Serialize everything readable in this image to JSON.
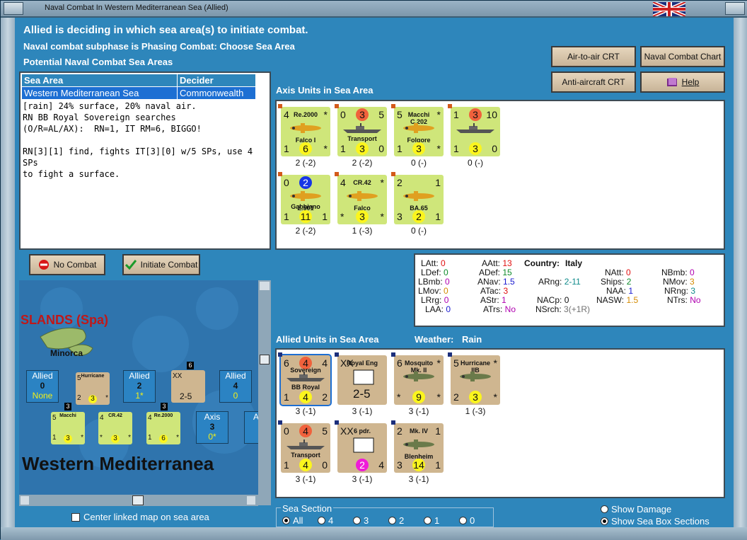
{
  "window": {
    "title": "Naval Combat In Western Mediterranean Sea (Allied)"
  },
  "header": {
    "line1": "Allied is deciding in which sea area(s) to initiate combat.",
    "line2": "Naval combat subphase is Phasing Combat: Choose Sea Area",
    "line3": "Potential Naval Combat Sea Areas"
  },
  "buttons": {
    "air_to_air": "Air-to-air CRT",
    "naval_chart": "Naval Combat Chart",
    "anti_aircraft": "Anti-aircraft CRT",
    "help": "Help",
    "no_combat": "No Combat",
    "initiate_combat": "Initiate Combat"
  },
  "sea_table": {
    "headers": [
      "Sea Area",
      "Decider"
    ],
    "rows": [
      [
        "Western Mediterranean Sea",
        "Commonwealth"
      ]
    ]
  },
  "log": "[rain] 24% surface, 20% naval air.\nRN BB Royal Sovereign searches\n(O/R=AL/AX):  RN=1, IT RM=6, BIGGO!\n\nRN[3][1] find, fights IT[3][0] w/5 SPs, use 4 SPs\nto fight a surface.",
  "axis_section": {
    "title": "Axis Units in Sea Area"
  },
  "allied_section": {
    "title": "Allied Units in Sea Area",
    "weather_label": "Weather:",
    "weather": "Rain"
  },
  "axis_units": [
    {
      "tl": "4",
      "name": "Re.2000",
      "sub": "Falco I",
      "bl": "1",
      "bm": "6",
      "br": "*",
      "tr": "*",
      "caption": "2 (-2)"
    },
    {
      "tl": "0",
      "tm": "3",
      "tr": "5",
      "name": "Transport",
      "bl": "1",
      "bm": "3",
      "br": "0",
      "caption": "2 (-2)"
    },
    {
      "tl": "5",
      "name": "Macchi",
      "name2": "C.202",
      "sub": "Folgore",
      "bl": "1",
      "bm": "3",
      "br": "*",
      "tr": "*",
      "caption": "0 (-)"
    },
    {
      "tl": "1",
      "tm": "3",
      "tr": "10",
      "bl": "1",
      "bm": "3",
      "br": "0",
      "caption": "0 (-)"
    },
    {
      "tl": "0",
      "name": "Gabbiano",
      "tm": "2",
      "sub": "Z.501",
      "bl": "1",
      "bm": "11",
      "br": "1",
      "caption": "2 (-2)"
    },
    {
      "tl": "4",
      "name": "CR.42",
      "sub": "Falco",
      "bl": "*",
      "bm": "3",
      "br": "*",
      "tr": "*",
      "caption": "1 (-3)"
    },
    {
      "tl": "2",
      "tr": "1",
      "sub": "BA.65",
      "bl": "3",
      "bm": "2",
      "br": "1",
      "caption": "0 (-)"
    }
  ],
  "allied_units": [
    {
      "tl": "6",
      "tm": "4",
      "tr": "4",
      "name": "BB Royal",
      "name2": "Sovereign",
      "bl": "1",
      "bm": "4",
      "br": "2",
      "caption": "3 (-1)"
    },
    {
      "tl": "XX",
      "name": "Royal Eng",
      "bm": "2-5",
      "caption": "3 (-1)"
    },
    {
      "tl": "6",
      "name": "Mosquito",
      "name2": "Mk. II",
      "bl": "*",
      "bm": "9",
      "br": "*",
      "tr": "*",
      "caption": "3 (-1)"
    },
    {
      "tl": "5",
      "name": "Hurricane",
      "name2": "IIB",
      "bl": "2",
      "bm": "3",
      "br": "*",
      "tr": "*",
      "caption": "1 (-3)"
    },
    {
      "tl": "0",
      "tm": "4",
      "tr": "5",
      "name": "Transport",
      "bl": "1",
      "bm": "4",
      "br": "0",
      "caption": "3 (-1)"
    },
    {
      "tl": "XX",
      "name": "6 pdr.",
      "bm": "2",
      "br": "4",
      "caption": "3 (-1)"
    },
    {
      "tl": "2",
      "tr": "1",
      "name": "Mk. IV",
      "sub": "Blenheim",
      "bl": "3",
      "bm": "14",
      "br": "1",
      "caption": "3 (-1)"
    }
  ],
  "stats": {
    "country_label": "Country:",
    "country": "Italy",
    "LAtt": "0",
    "LDef": "0",
    "LBmb": "0",
    "LMov": "0",
    "LRrg": "0",
    "LAA": "0",
    "AAtt": "13",
    "ADef": "15",
    "ANav": "1.5",
    "ATac": "3",
    "AStr": "1",
    "ATrs": "No",
    "ARng": "2-11",
    "NACp": "0",
    "NSrch": "3",
    "NSrch_extra": "(+1R)",
    "NAtt": "0",
    "Ships": "2",
    "NAA": "1",
    "NASW": "1.5",
    "NBmb": "0",
    "NMov": "3",
    "NRng": "3",
    "NTrs": "No"
  },
  "map": {
    "region": "SLANDS (Spa)",
    "island": "Minorca",
    "sea_name": "Western Mediterranea",
    "boxes": [
      {
        "side": "Allied",
        "value": "0",
        "note": "None"
      },
      {
        "side": "Allied",
        "value": "2",
        "note": "1*"
      },
      {
        "side": "Allied",
        "value": "4",
        "note": "0"
      },
      {
        "side": "Axis",
        "value": "3",
        "note": "0*"
      },
      {
        "side": "As",
        "value": "",
        "note": ""
      }
    ],
    "stack_counts": [
      "6",
      "3",
      "3",
      "3"
    ],
    "counters": [
      {
        "tl": "5",
        "name": "Hurricane",
        "name2": "IIB",
        "bl": "2",
        "bm": "3",
        "br": "*"
      },
      {
        "tl": "XX",
        "name": "",
        "bm": "2-5"
      },
      {
        "tl": "5",
        "name": "Macchi",
        "name2": "C.202",
        "sub": "Folgore",
        "bl": "1",
        "bm": "3",
        "br": "*"
      },
      {
        "tl": "4",
        "name": "CR.42",
        "sub": "Falco",
        "bl": "*",
        "bm": "3",
        "br": "*"
      },
      {
        "tl": "4",
        "name": "Re.2000",
        "sub": "Falco I",
        "bl": "1",
        "bm": "6",
        "br": "*"
      }
    ]
  },
  "bottom": {
    "center_map": "Center linked map on sea area",
    "sea_section_label": "Sea Section",
    "sea_section_options": [
      "All",
      "4",
      "3",
      "2",
      "1",
      "0"
    ],
    "show_damage": "Show Damage",
    "show_sea_box": "Show Sea Box Sections"
  },
  "colors": {
    "frame_blue": "#2e86bb",
    "axis_counter": "#cfe67a",
    "allied_counter": "#cfb690",
    "selection": "#1d6fd3"
  }
}
